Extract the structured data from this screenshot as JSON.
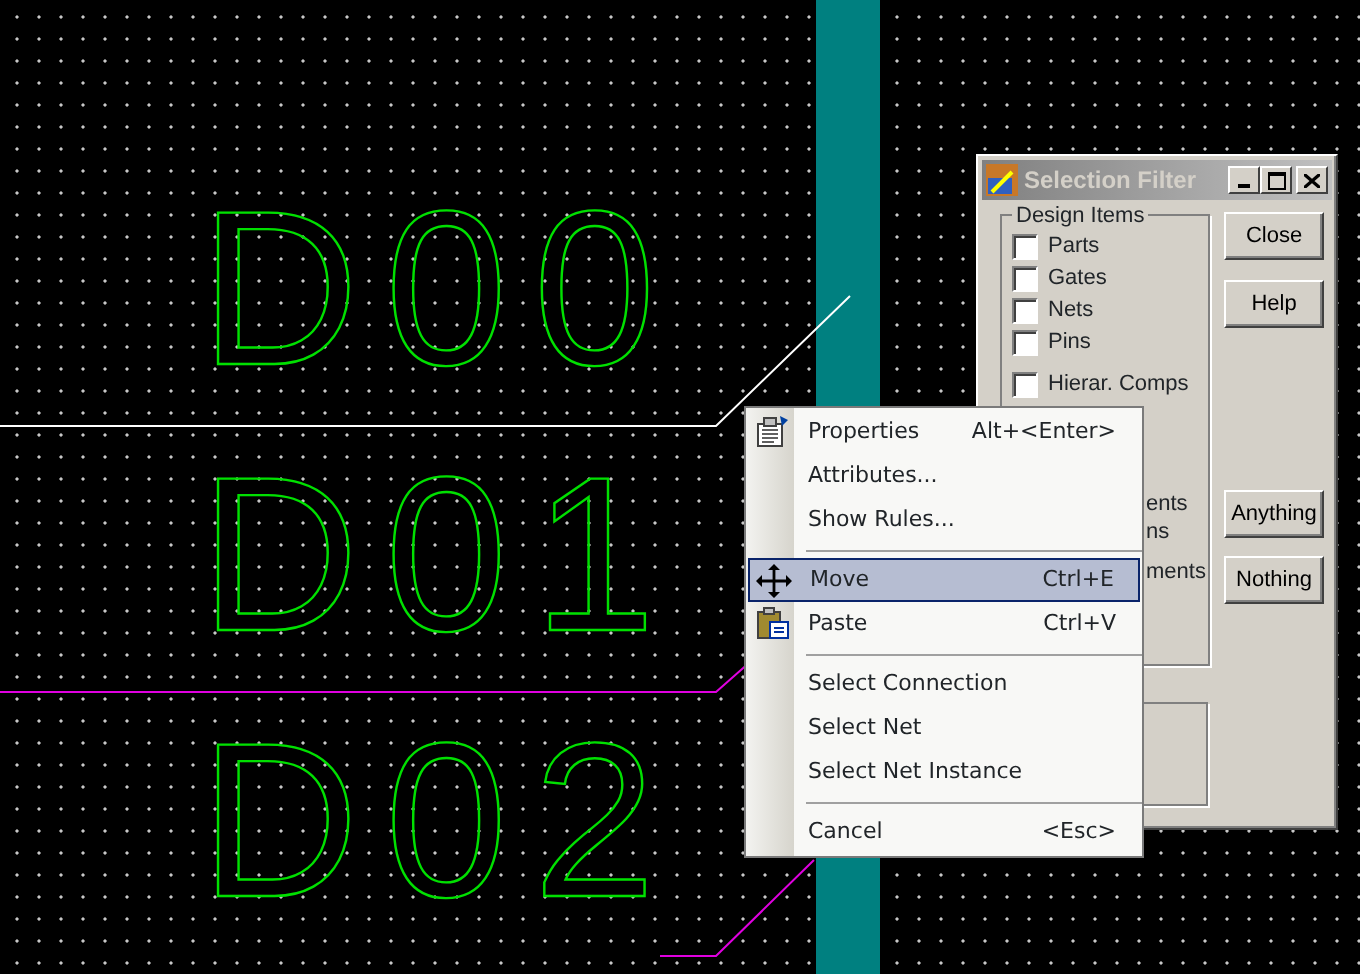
{
  "canvas": {
    "labels": [
      "D00",
      "D01",
      "D02"
    ]
  },
  "selection_filter": {
    "title": "Selection Filter",
    "group_title": "Design Items",
    "items": [
      {
        "label": "Parts",
        "checked": false
      },
      {
        "label": "Gates",
        "checked": false
      },
      {
        "label": "Nets",
        "checked": false
      },
      {
        "label": "Pins",
        "checked": false
      },
      {
        "label": "Hierar. Comps",
        "checked": false
      }
    ],
    "covered_labels": [
      "ents",
      "ns",
      "ments"
    ],
    "buttons": [
      "Close",
      "Help",
      "Anything",
      "Nothing"
    ]
  },
  "context_menu": {
    "items": [
      {
        "kind": "item",
        "label": "Properties",
        "shortcut": "Alt+<Enter>",
        "selected": false
      },
      {
        "kind": "item",
        "label": "Attributes...",
        "selected": false
      },
      {
        "kind": "item",
        "label": "Show Rules...",
        "selected": false
      },
      {
        "kind": "separator"
      },
      {
        "kind": "item",
        "label": "Move",
        "shortcut": "Ctrl+E",
        "selected": true
      },
      {
        "kind": "item",
        "label": "Paste",
        "shortcut": "Ctrl+V",
        "selected": false
      },
      {
        "kind": "separator"
      },
      {
        "kind": "item",
        "label": "Select Connection",
        "selected": false
      },
      {
        "kind": "item",
        "label": "Select Net",
        "selected": false
      },
      {
        "kind": "item",
        "label": "Select Net Instance",
        "selected": false
      },
      {
        "kind": "separator"
      },
      {
        "kind": "item",
        "label": "Cancel",
        "shortcut": "<Esc>",
        "selected": false
      }
    ]
  }
}
